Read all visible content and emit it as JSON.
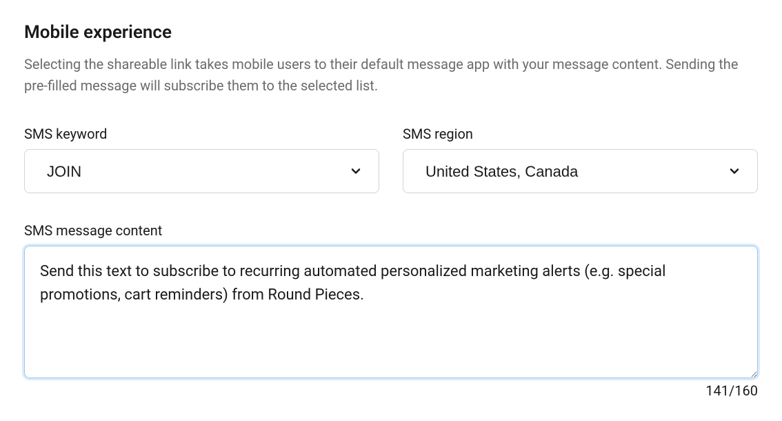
{
  "section": {
    "title": "Mobile experience",
    "description": "Selecting the shareable link takes mobile users to their default message app with your message content. Sending the pre-filled message will subscribe them to the selected list."
  },
  "fields": {
    "sms_keyword": {
      "label": "SMS keyword",
      "value": "JOIN"
    },
    "sms_region": {
      "label": "SMS region",
      "value": "United States, Canada"
    },
    "sms_content": {
      "label": "SMS message content",
      "value": "Send this text to subscribe to recurring automated personalized marketing alerts (e.g. special promotions, cart reminders) from Round Pieces.",
      "counter": "141/160"
    }
  }
}
